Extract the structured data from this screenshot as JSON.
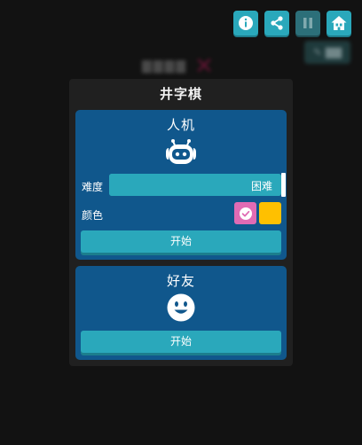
{
  "colors": {
    "accent": "#2aa8bb",
    "card": "#10578c",
    "panel": "#202020",
    "pink": "#e06bb4",
    "yellow": "#ffc000"
  },
  "toolbar": {
    "items": [
      {
        "icon": "info-icon"
      },
      {
        "icon": "share-icon"
      },
      {
        "icon": "pause-icon",
        "disabled": true
      },
      {
        "icon": "home-icon"
      }
    ]
  },
  "background": {
    "title_icon": "close-icon",
    "edit_icon": "edit-icon"
  },
  "modal": {
    "title": "井字棋",
    "ai_card": {
      "title": "人机",
      "icon": "robot-icon",
      "difficulty_label": "难度",
      "difficulty_value": "困难",
      "difficulty_level": 1.0,
      "color_label": "颜色",
      "color_options": [
        {
          "color": "#e06bb4",
          "selected": true
        },
        {
          "color": "#ffc000",
          "selected": false
        }
      ],
      "start_label": "开始"
    },
    "friend_card": {
      "title": "好友",
      "icon": "smiley-icon",
      "start_label": "开始"
    }
  }
}
